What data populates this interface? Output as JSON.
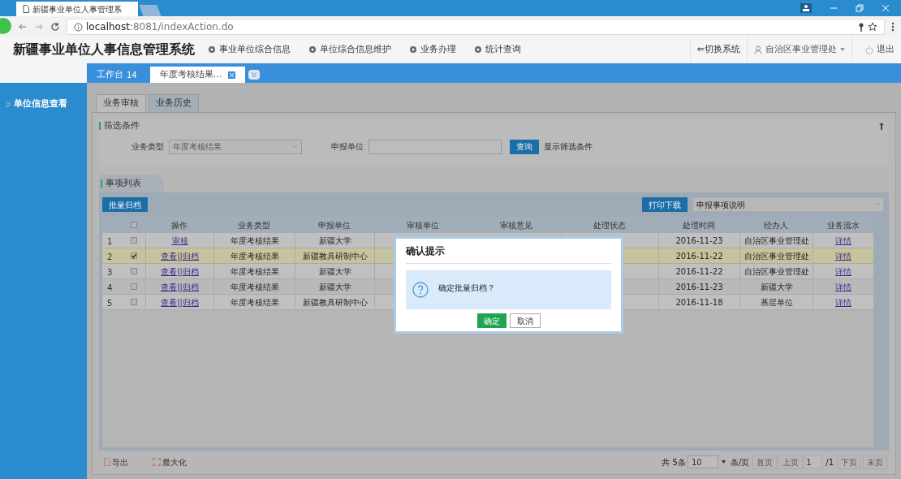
{
  "browser": {
    "tab_title": "新疆事业单位人事管理系",
    "url_host": "localhost",
    "url_rest": ":8081/indexAction.do"
  },
  "app": {
    "title": "新疆事业单位人事信息管理系统",
    "nav": [
      "事业单位综合信息",
      "单位综合信息维护",
      "业务办理",
      "统计查询"
    ],
    "switch": "⇐切换系统",
    "user": "自治区事业管理处",
    "logout": "退出"
  },
  "tabs": [
    {
      "label": "工作台",
      "badge": "14",
      "selected": false
    },
    {
      "label": "年度考核结果...",
      "selected": true
    }
  ],
  "sidebar": {
    "items": [
      "单位信息查看"
    ]
  },
  "subtabs": [
    {
      "label": "业务审核",
      "selected": false
    },
    {
      "label": "业务历史",
      "selected": true
    }
  ],
  "filter": {
    "title": "筛选条件",
    "type_label": "业务类型",
    "type_value": "年度考核结果",
    "unit_label": "申报单位",
    "search_button": "查询",
    "show_link": "显示筛选条件"
  },
  "list": {
    "title": "事项列表",
    "batch_button": "批量归档",
    "print_button": "打印下载",
    "print_select": "申报事项说明"
  },
  "table": {
    "all_checked": false,
    "columns": [
      "操作",
      "业务类型",
      "申报单位",
      "审核单位",
      "审核意见",
      "处理状态",
      "处理时间",
      "经办人",
      "业务流水"
    ],
    "rows": [
      {
        "index": "1",
        "checked": false,
        "selected": false,
        "action": "审核",
        "type": "年度考核结果",
        "unit": "新疆大学",
        "time": "2016-11-23",
        "handler": "自治区事业管理处",
        "flow": "详情"
      },
      {
        "index": "2",
        "checked": true,
        "selected": true,
        "action": "查看||归档",
        "type": "年度考核结果",
        "unit": "新疆教具研制中心",
        "time": "2016-11-22",
        "handler": "自治区事业管理处",
        "flow": "详情"
      },
      {
        "index": "3",
        "checked": false,
        "selected": false,
        "action": "查看||归档",
        "type": "年度考核结果",
        "unit": "新疆大学",
        "time": "2016-11-22",
        "handler": "自治区事业管理处",
        "flow": "详情"
      },
      {
        "index": "4",
        "checked": false,
        "selected": false,
        "action": "查看||归档",
        "type": "年度考核结果",
        "unit": "新疆大学",
        "time": "2016-11-23",
        "handler": "新疆大学",
        "flow": "详情"
      },
      {
        "index": "5",
        "checked": false,
        "selected": false,
        "action": "查看||归档",
        "type": "年度考核结果",
        "unit": "新疆教具研制中心",
        "time": "2016-11-18",
        "handler": "基层单位",
        "flow": "详情"
      }
    ]
  },
  "footer": {
    "export": "导出",
    "maximize": "最大化",
    "total": "共 5条",
    "page_size": "10",
    "per_page": "条/页",
    "first": "首页",
    "prev": "上页",
    "page": "1",
    "pages": "/1",
    "next": "下页",
    "last": "末页"
  },
  "dialog": {
    "title": "确认提示",
    "message": "确定批量归档？",
    "ok": "确定",
    "cancel": "取消"
  }
}
